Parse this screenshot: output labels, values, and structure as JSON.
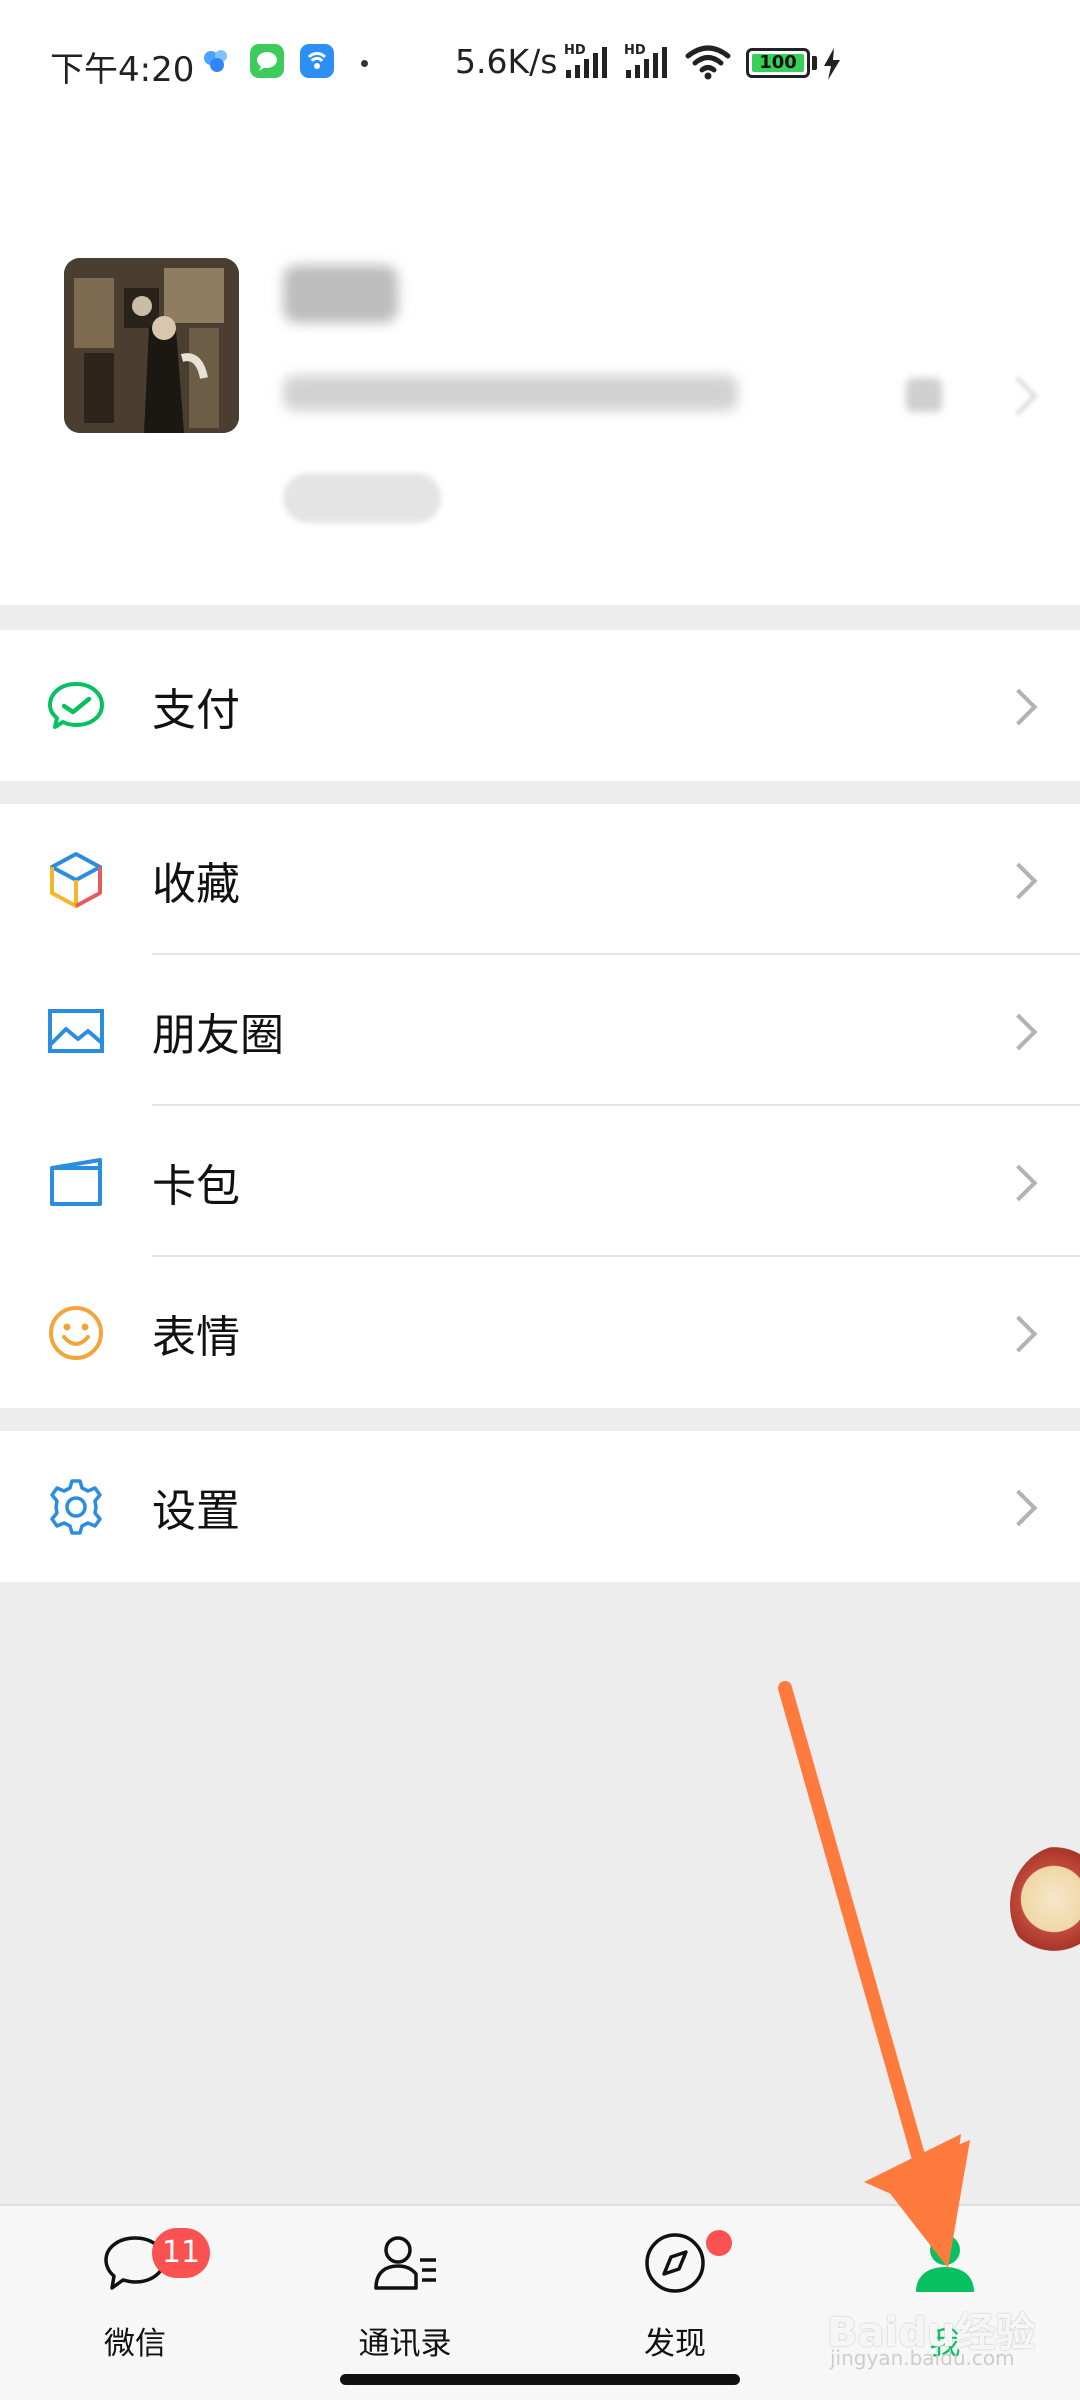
{
  "status_bar": {
    "time": "下午4:20",
    "network_speed": "5.6K/s",
    "battery": "100",
    "signal_label_1": "HD",
    "signal_label_2": "HD"
  },
  "menu": {
    "pay": "支付",
    "favorites": "收藏",
    "moments": "朋友圈",
    "cards": "卡包",
    "stickers": "表情",
    "settings": "设置"
  },
  "tabs": {
    "chats": "微信",
    "chats_badge": "11",
    "contacts": "通讯录",
    "discover": "发现",
    "me": "我"
  },
  "watermark": {
    "text": "Baidu经验",
    "sub": "jingyan.baidu.com"
  },
  "colors": {
    "accent": "#07c160",
    "badge": "#fa5151",
    "annotation_arrow": "#ff7a3d"
  }
}
